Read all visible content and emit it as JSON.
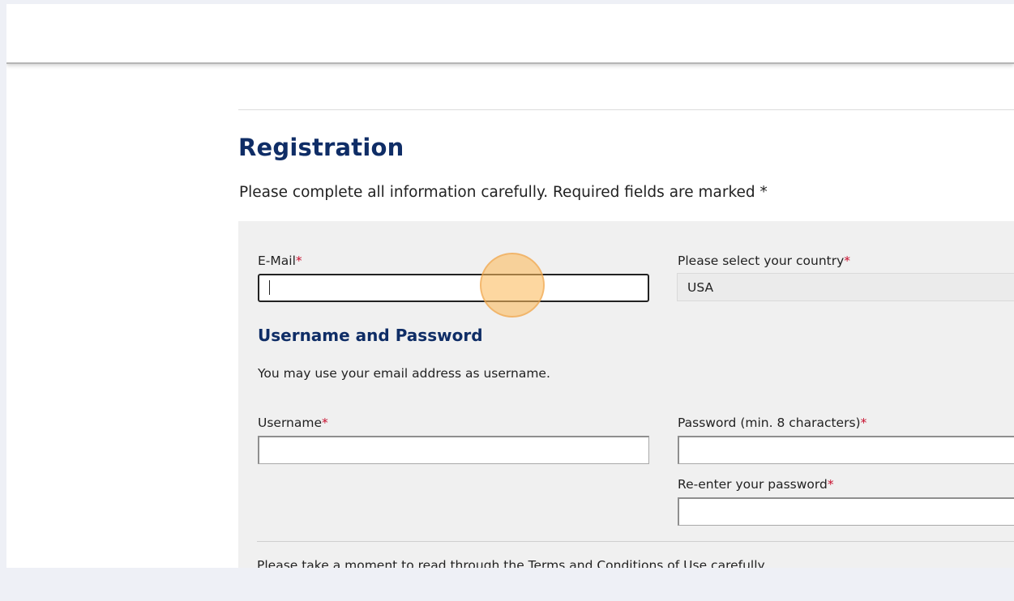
{
  "page": {
    "title": "Registration",
    "intro": "Please complete all information carefully. Required fields are marked *"
  },
  "form": {
    "required_marker": "*",
    "email": {
      "label": "E-Mail",
      "value": ""
    },
    "country": {
      "label": "Please select your country",
      "selected": "USA"
    },
    "credentials_section": {
      "title": "Username and Password",
      "hint": "You may use your email address as username."
    },
    "username": {
      "label": "Username",
      "value": ""
    },
    "password": {
      "label": "Password (min. 8 characters)",
      "value": ""
    },
    "password_confirm": {
      "label": "Re-enter your password",
      "value": ""
    },
    "terms_text": "Please take a moment to read through the Terms and Conditions of Use carefully."
  },
  "colors": {
    "heading": "#0f2d66",
    "required": "#c8102e",
    "panel": "#f0f0f0",
    "click_indicator": "#fcba5c"
  }
}
